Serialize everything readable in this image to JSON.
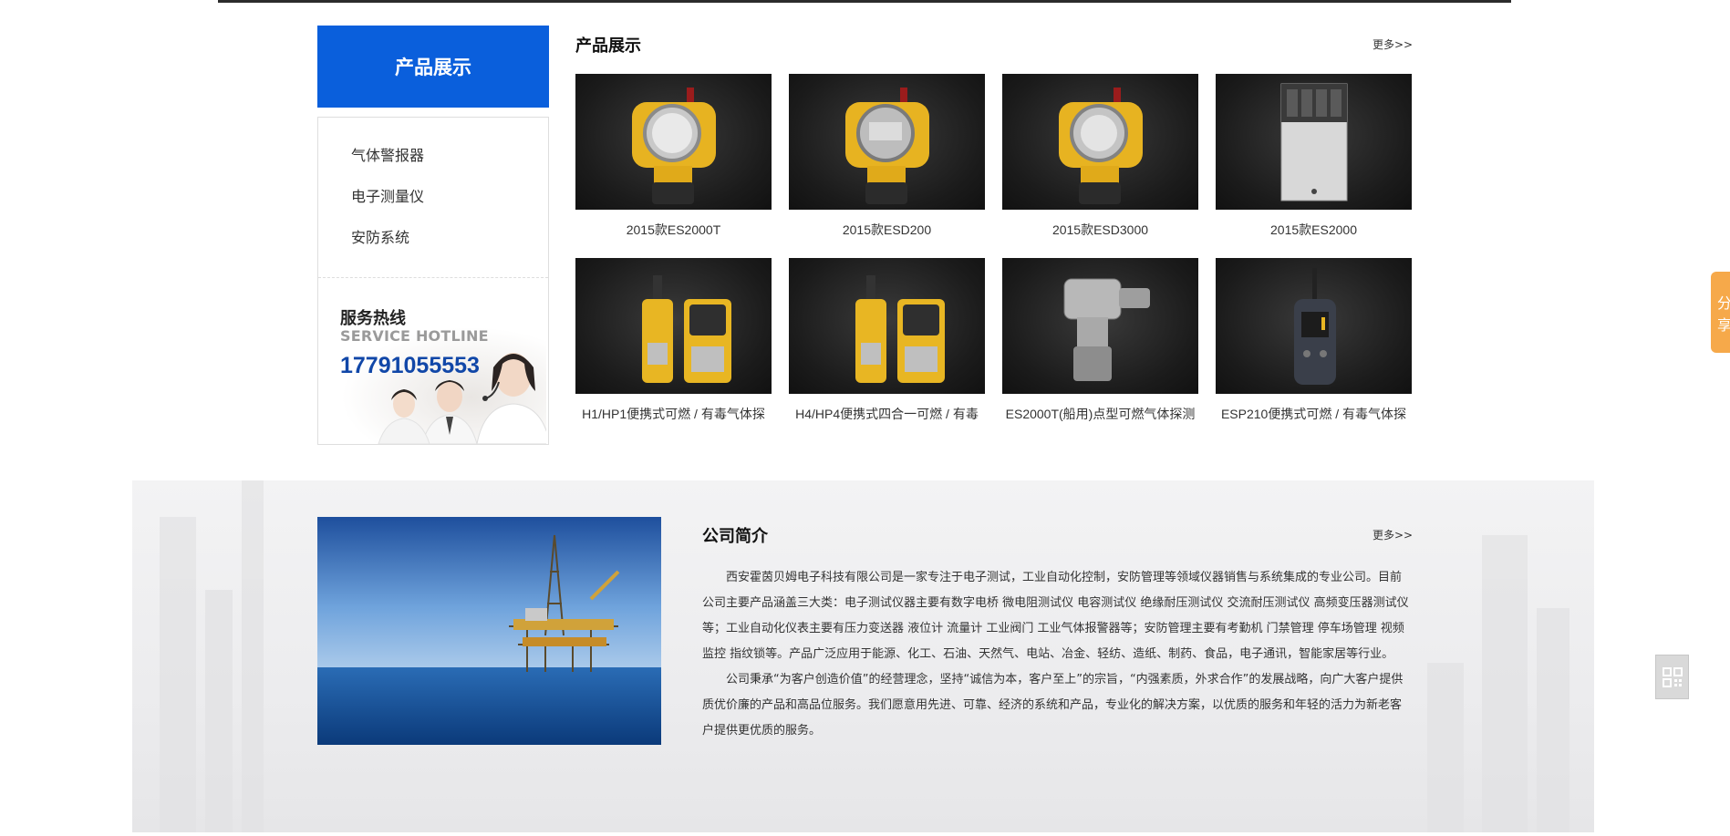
{
  "sidebar": {
    "title": "产品展示",
    "items": [
      {
        "label": "气体警报器"
      },
      {
        "label": "电子测量仪"
      },
      {
        "label": "安防系统"
      }
    ],
    "hotline": {
      "title": "服务热线",
      "subtitle": "SERVICE HOTLINE",
      "number": "17791055553"
    }
  },
  "products": {
    "title": "产品展示",
    "more": "更多>>",
    "items": [
      {
        "name": "2015款ES2000T",
        "icon": "yellow-gas-detector"
      },
      {
        "name": "2015款ESD200",
        "icon": "yellow-gas-detector"
      },
      {
        "name": "2015款ESD3000",
        "icon": "yellow-gas-detector"
      },
      {
        "name": "2015款ES2000",
        "icon": "control-panel"
      },
      {
        "name": "H1/HP1便携式可燃 / 有毒气体探",
        "icon": "portable-detector"
      },
      {
        "name": "H4/HP4便携式四合一可燃 / 有毒",
        "icon": "portable-detector"
      },
      {
        "name": "ES2000T(船用)点型可燃气体探测",
        "icon": "steel-detector"
      },
      {
        "name": "ESP210便携式可燃 / 有毒气体探",
        "icon": "handheld-detector"
      }
    ]
  },
  "company": {
    "title": "公司简介",
    "more": "更多>>",
    "paragraphs": [
      "西安霍茵贝姆电子科技有限公司是一家专注于电子测试，工业自动化控制，安防管理等领域仪器销售与系统集成的专业公司。目前公司主要产品涵盖三大类：电子测试仪器主要有数字电桥 微电阻测试仪 电容测试仪 绝缘耐压测试仪 交流耐压测试仪 高频变压器测试仪等；工业自动化仪表主要有压力变送器 液位计 流量计 工业阀门 工业气体报警器等；安防管理主要有考勤机 门禁管理 停车场管理 视频监控 指纹锁等。产品广泛应用于能源、化工、石油、天然气、电站、冶金、轻纺、造纸、制药、食品，电子通讯，智能家居等行业。",
      "公司秉承“为客户创造价值”的经营理念，坚持“诚信为本，客户至上”的宗旨，“内强素质，外求合作”的发展战略，向广大客户提供质优价廉的产品和高品位服务。我们愿意用先进、可靠、经济的系统和产品，专业化的解决方案，以优质的服务和年轻的活力为新老客户提供更优质的服务。"
    ]
  },
  "widgets": {
    "share_label": [
      "分",
      "享"
    ],
    "qr_icon": "qr-code-icon"
  },
  "colors": {
    "accent": "#0a5fdc",
    "hotline": "#1147a8",
    "share": "#f6a94a"
  }
}
